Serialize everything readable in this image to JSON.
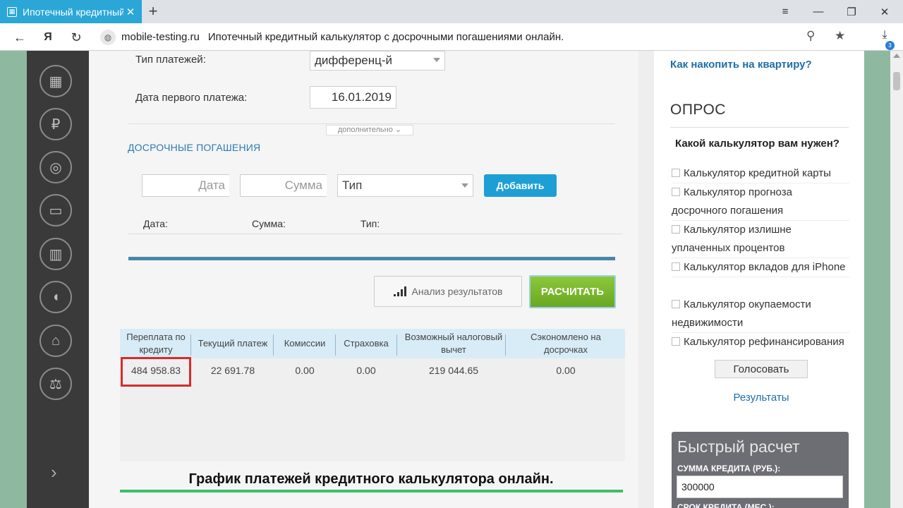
{
  "browser": {
    "tab_title": "Ипотечный кредитный",
    "domain": "mobile-testing.ru",
    "page_title": "Ипотечный кредитный калькулятор с досрочными погашениями онлайн.",
    "downloads_badge": "3"
  },
  "form": {
    "payment_type_label": "Тип платежей:",
    "payment_type_value": "дифференц-й",
    "first_payment_label": "Дата первого платежа:",
    "first_payment_value": "16.01.2019",
    "extra_toggle": "дополнительно",
    "early_section_title": "ДОСРОЧНЫЕ ПОГАШЕНИЯ",
    "date_placeholder": "Дата",
    "sum_placeholder": "Сумма",
    "type_placeholder": "Тип",
    "add_button": "Добавить",
    "col_date": "Дата:",
    "col_sum": "Сумма:",
    "col_type": "Тип:",
    "analysis_button": "Анализ результатов",
    "calc_button": "РАСЧИТАТЬ"
  },
  "results": {
    "headers": [
      "Переплата по кредиту",
      "Текущий платеж",
      "Комиссии",
      "Страховка",
      "Возможный налоговый вычет",
      "Сэкономлено на досрочках"
    ],
    "values": [
      "484 958.83",
      "22 691.78",
      "0.00",
      "0.00",
      "219 044.65",
      "0.00"
    ]
  },
  "graph_title": "График платежей кредитного калькулятора онлайн.",
  "right": {
    "top_link": "Как накопить на квартиру?",
    "poll_title": "ОПРОС",
    "poll_question": "Какой калькулятор вам нужен?",
    "poll_options": [
      "Калькулятор кредитной карты",
      "Калькулятор прогноза досрочного погашения",
      "Калькулятор излишне уплаченных процентов",
      "Калькулятор вкладов для iPhone",
      "Калькулятор окупаемости недвижимости",
      "Калькулятор рефинансирования"
    ],
    "vote_button": "Голосовать",
    "results_link": "Результаты",
    "quick_title": "Быстрый расчет",
    "quick_sum_label": "СУММА КРЕДИТА (РУБ.):",
    "quick_sum_value": "300000",
    "quick_term_label": "СРОК КРЕДИТА (МЕС.):"
  },
  "icons": {
    "sidebar": [
      "calculator-icon",
      "ruble-hand-icon",
      "coins-icon",
      "card-icon",
      "chart-down-icon",
      "piggy-bank-icon",
      "bank-icon",
      "scales-icon"
    ],
    "sidebar_arrow": "chevron-right-icon"
  },
  "colors": {
    "tab_active": "#2aa7d6",
    "sidebar_bg": "#3a3a3a",
    "accent_blue": "#1d9fd6",
    "calc_green": "#6aa723",
    "highlight_red": "#d92a2a",
    "page_bg": "#8fb8a0"
  }
}
